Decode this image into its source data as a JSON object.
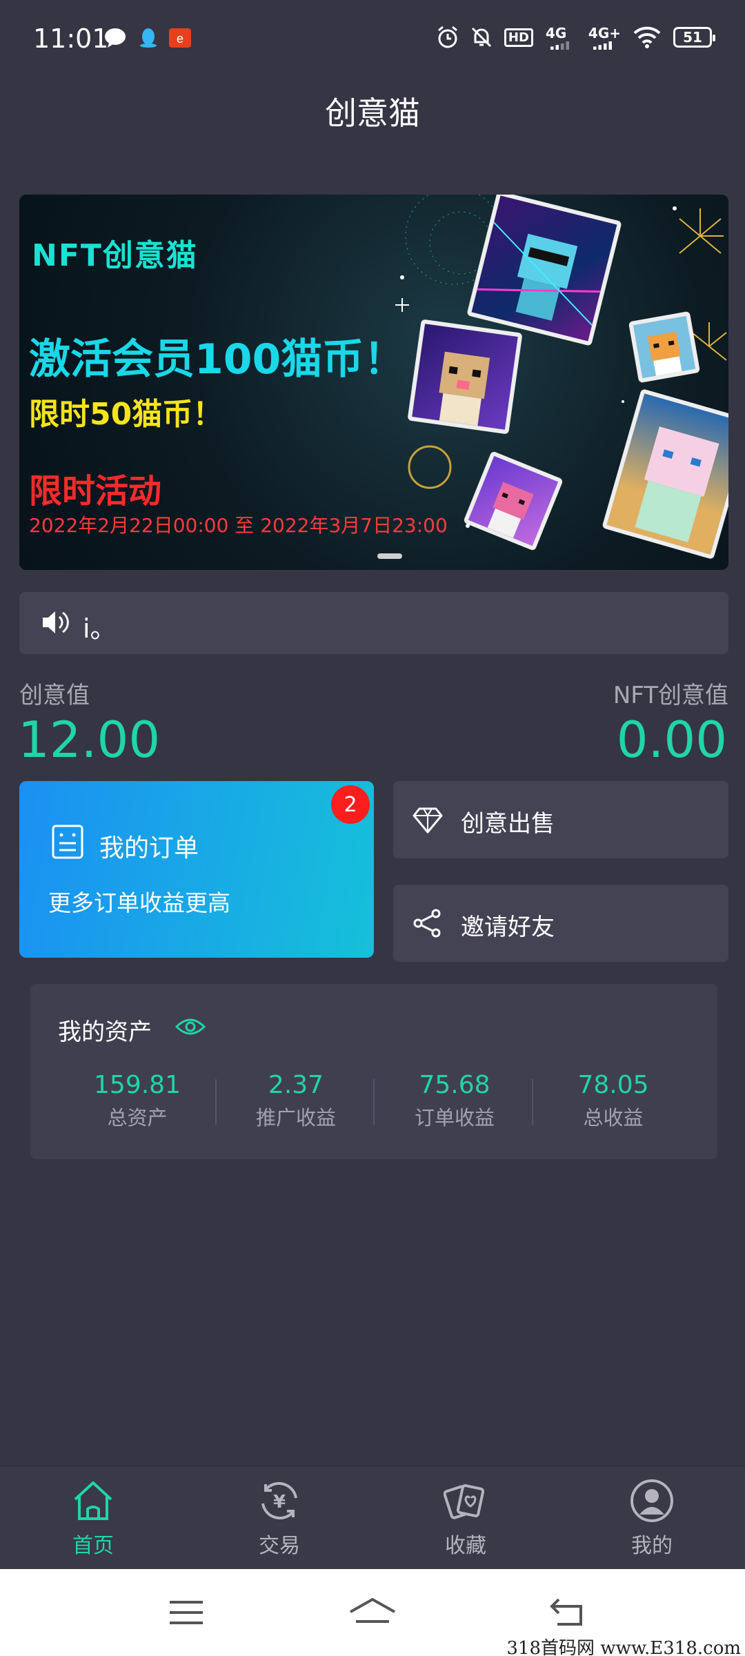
{
  "status_bar": {
    "time": "11:01",
    "signal_1": "4G",
    "signal_2": "4G+",
    "battery": "51",
    "hd_label": "HD"
  },
  "app": {
    "title": "创意猫"
  },
  "banner": {
    "brand": "NFT创意猫",
    "headline": "激活会员100猫币！",
    "sub": "限时50猫币！",
    "event": "限时活动",
    "dates": "2022年2月22日00:00 至 2022年3月7日23:00"
  },
  "notice": {
    "text": "i。"
  },
  "values": {
    "creative_label": "创意值",
    "creative_value": "12.00",
    "nft_label": "NFT创意值",
    "nft_value": "0.00"
  },
  "order_card": {
    "title": "我的订单",
    "desc": "更多订单收益更高",
    "badge": "2"
  },
  "actions": {
    "sell_label": "创意出售",
    "invite_label": "邀请好友"
  },
  "assets": {
    "title": "我的资产",
    "items": [
      {
        "value": "159.81",
        "label": "总资产"
      },
      {
        "value": "2.37",
        "label": "推广收益"
      },
      {
        "value": "75.68",
        "label": "订单收益"
      },
      {
        "value": "78.05",
        "label": "总收益"
      }
    ]
  },
  "bottom_nav": {
    "items": [
      {
        "label": "首页",
        "icon": "home-icon",
        "active": true
      },
      {
        "label": "交易",
        "icon": "yuan-exchange-icon",
        "active": false
      },
      {
        "label": "收藏",
        "icon": "cards-icon",
        "active": false
      },
      {
        "label": "我的",
        "icon": "user-icon",
        "active": false
      }
    ]
  },
  "watermark": "318首码网 www.E318.com",
  "colors": {
    "background": "#363544",
    "accent": "#1fd6a6",
    "panel": "#444354",
    "badge": "#ff1e1e"
  }
}
